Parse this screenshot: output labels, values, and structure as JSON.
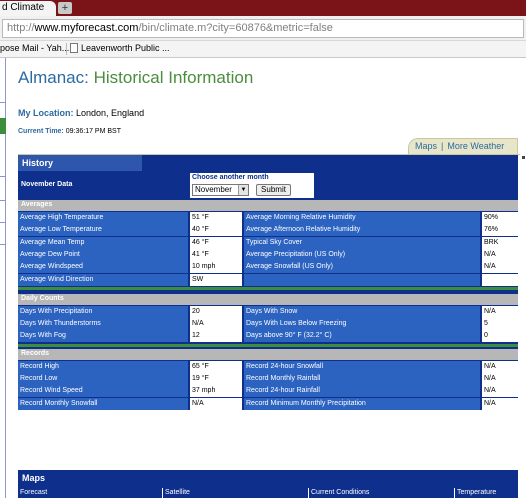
{
  "browser": {
    "tab_title": "d Climate",
    "new_tab": "+",
    "url_prefix": "http://",
    "url_domain": "www.myforecast.com",
    "url_path": "/bin/climate.m?city=60876&metric=false",
    "bookmarks": [
      "pose Mail - Yah...",
      "Leavenworth Public ..."
    ]
  },
  "page": {
    "title_main": "Almanac:",
    "title_rest": "Historical Information",
    "location_label": "My Location:",
    "location_value": "London, England",
    "time_label": "Current Time:",
    "time_value": "09:36:17 PM BST",
    "tab_links": [
      "Maps",
      "More Weather"
    ],
    "tab_sep": "|"
  },
  "history": {
    "heading": "History",
    "data_label": "November Data",
    "choose_label": "Choose another month",
    "selected_month": "November",
    "submit_label": "Submit",
    "sections": [
      {
        "name": "Averages",
        "rows": [
          [
            "Average High Temperature",
            "51 °F",
            "Average Morning Relative Humidity",
            "90%"
          ],
          [
            "Average Low Temperature",
            "40 °F",
            "Average Afternoon Relative Humidity",
            "76%"
          ],
          [
            "Average Mean Temp",
            "46 °F",
            "Typical Sky Cover",
            "BRK"
          ],
          [
            "Average Dew Point",
            "41 °F",
            "Average Precipitation (US Only)",
            "N/A"
          ],
          [
            "Average Windspeed",
            "10 mph",
            "Average Snowfall (US Only)",
            "N/A"
          ],
          [
            "Average Wind Direction",
            "SW",
            "",
            ""
          ]
        ]
      },
      {
        "name": "Daily Counts",
        "rows": [
          [
            "Days With Precipitation",
            "20",
            "Days With Snow",
            "N/A"
          ],
          [
            "Days With Thunderstorms",
            "N/A",
            "Days With Lows Below Freezing",
            "5"
          ],
          [
            "Days With Fog",
            "12",
            "Days above 90° F (32.2° C)",
            "0"
          ]
        ]
      },
      {
        "name": "Records",
        "rows": [
          [
            "Record High",
            "65 °F",
            "Record 24-hour Snowfall",
            "N/A"
          ],
          [
            "Record Low",
            "19 °F",
            "Record Monthly Rainfall",
            "N/A"
          ],
          [
            "Record Wind Speed",
            "37 mph",
            "Record 24-hour Rainfall",
            "N/A"
          ],
          [
            "Record Monthly Snowfall",
            "N/A",
            "Record Minimum Monthly Precipitation",
            "N/A"
          ]
        ]
      }
    ]
  },
  "maps": {
    "heading": "Maps",
    "columns": [
      "Forecast",
      "Satellite",
      "Current Conditions",
      "Temperature"
    ]
  },
  "colors": {
    "panel_blue": "#0e2f8c",
    "label_blue": "#2c63c0",
    "title_blue": "#2c6aa0",
    "title_green": "#4a8d3c",
    "section_gray": "#b7b7b7",
    "tab_red": "#7a1418"
  }
}
